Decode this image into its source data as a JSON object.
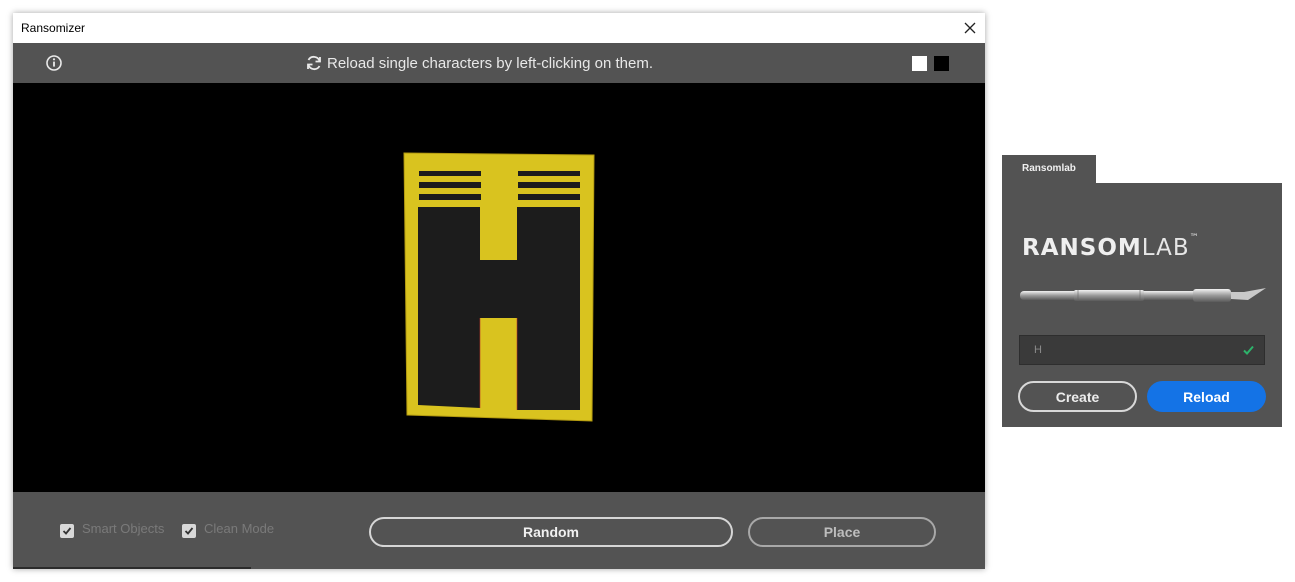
{
  "window": {
    "title": "Ransomizer",
    "hint": "Reload single characters by left-clicking on them.",
    "preview_character": "H",
    "background_swatches": [
      "#ffffff",
      "#000000"
    ],
    "options": [
      {
        "label": "Smart Objects",
        "checked": true
      },
      {
        "label": "Clean Mode",
        "checked": true
      }
    ],
    "buttons": {
      "random": "Random",
      "place": "Place"
    }
  },
  "panel": {
    "tab_label": "Ransomlab",
    "logo": {
      "bold": "RANSOM",
      "light": "LAB",
      "mark": "™"
    },
    "input": {
      "value": "H",
      "valid": true
    },
    "buttons": {
      "create": "Create",
      "reload": "Reload"
    },
    "accent_color": "#1473e6"
  },
  "colors": {
    "panel_bg": "#535353",
    "canvas_bg": "#000000",
    "letter_paper": "#d9c31f",
    "letter_ink": "#1c1c1c"
  }
}
